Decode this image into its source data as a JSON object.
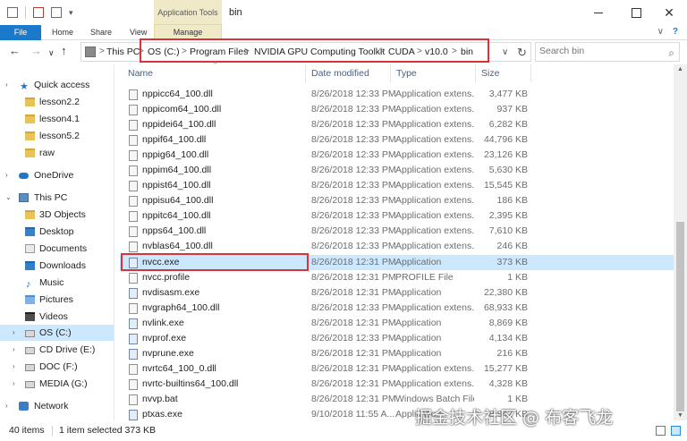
{
  "window": {
    "title": "bin",
    "contextual_tab_group": "Application Tools",
    "close_glyph": "✕"
  },
  "ribbon": {
    "tabs": [
      "File",
      "Home",
      "Share",
      "View",
      "Manage"
    ],
    "collapse_glyph": "∨",
    "help_glyph": "?"
  },
  "address": {
    "back": "←",
    "forward": "→",
    "recent": "∨",
    "up": "↑",
    "crumbs": [
      "This PC",
      "OS (C:)",
      "Program Files",
      "NVIDIA GPU Computing Toolkit",
      "CUDA",
      "v10.0",
      "bin"
    ],
    "separator": ">",
    "refresh": "↻"
  },
  "search": {
    "placeholder": "Search bin"
  },
  "nav_pane": {
    "items": [
      {
        "label": "Quick access",
        "icon": "star-icon"
      },
      {
        "label": "lesson2.2",
        "icon": "folder-icon"
      },
      {
        "label": "lesson4.1",
        "icon": "folder-icon"
      },
      {
        "label": "lesson5.2",
        "icon": "folder-icon"
      },
      {
        "label": "raw",
        "icon": "folder-icon"
      },
      {
        "label": "OneDrive",
        "icon": "cloud-icon"
      },
      {
        "label": "This PC",
        "icon": "computer-icon"
      },
      {
        "label": "3D Objects",
        "icon": "folder-icon"
      },
      {
        "label": "Desktop",
        "icon": "folder-icon"
      },
      {
        "label": "Documents",
        "icon": "folder-icon"
      },
      {
        "label": "Downloads",
        "icon": "folder-icon"
      },
      {
        "label": "Music",
        "icon": "music-icon"
      },
      {
        "label": "Pictures",
        "icon": "folder-icon"
      },
      {
        "label": "Videos",
        "icon": "folder-icon"
      },
      {
        "label": "OS (C:)",
        "icon": "drive-icon",
        "selected": true
      },
      {
        "label": "CD Drive (E:)",
        "icon": "drive-icon"
      },
      {
        "label": "DOC (F:)",
        "icon": "drive-icon"
      },
      {
        "label": "MEDIA (G:)",
        "icon": "drive-icon"
      },
      {
        "label": "Network",
        "icon": "network-icon"
      }
    ]
  },
  "columns": {
    "name": "Name",
    "date": "Date modified",
    "type": "Type",
    "size": "Size"
  },
  "files": [
    {
      "name": "nppicc64_100.dll",
      "date": "8/26/2018 12:33 PM",
      "type": "Application extens...",
      "size": "3,477 KB"
    },
    {
      "name": "nppicom64_100.dll",
      "date": "8/26/2018 12:33 PM",
      "type": "Application extens...",
      "size": "937 KB"
    },
    {
      "name": "nppidei64_100.dll",
      "date": "8/26/2018 12:33 PM",
      "type": "Application extens...",
      "size": "6,282 KB"
    },
    {
      "name": "nppif64_100.dll",
      "date": "8/26/2018 12:33 PM",
      "type": "Application extens...",
      "size": "44,796 KB"
    },
    {
      "name": "nppig64_100.dll",
      "date": "8/26/2018 12:33 PM",
      "type": "Application extens...",
      "size": "23,126 KB"
    },
    {
      "name": "nppim64_100.dll",
      "date": "8/26/2018 12:33 PM",
      "type": "Application extens...",
      "size": "5,630 KB"
    },
    {
      "name": "nppist64_100.dll",
      "date": "8/26/2018 12:33 PM",
      "type": "Application extens...",
      "size": "15,545 KB"
    },
    {
      "name": "nppisu64_100.dll",
      "date": "8/26/2018 12:33 PM",
      "type": "Application extens...",
      "size": "186 KB"
    },
    {
      "name": "nppitc64_100.dll",
      "date": "8/26/2018 12:33 PM",
      "type": "Application extens...",
      "size": "2,395 KB"
    },
    {
      "name": "npps64_100.dll",
      "date": "8/26/2018 12:33 PM",
      "type": "Application extens...",
      "size": "7,610 KB"
    },
    {
      "name": "nvblas64_100.dll",
      "date": "8/26/2018 12:33 PM",
      "type": "Application extens...",
      "size": "246 KB"
    },
    {
      "name": "nvcc.exe",
      "date": "8/26/2018 12:31 PM",
      "type": "Application",
      "size": "373 KB",
      "selected": true
    },
    {
      "name": "nvcc.profile",
      "date": "8/26/2018 12:31 PM",
      "type": "PROFILE File",
      "size": "1 KB"
    },
    {
      "name": "nvdisasm.exe",
      "date": "8/26/2018 12:31 PM",
      "type": "Application",
      "size": "22,380 KB"
    },
    {
      "name": "nvgraph64_100.dll",
      "date": "8/26/2018 12:33 PM",
      "type": "Application extens...",
      "size": "68,933 KB"
    },
    {
      "name": "nvlink.exe",
      "date": "8/26/2018 12:31 PM",
      "type": "Application",
      "size": "8,869 KB"
    },
    {
      "name": "nvprof.exe",
      "date": "8/26/2018 12:33 PM",
      "type": "Application",
      "size": "4,134 KB"
    },
    {
      "name": "nvprune.exe",
      "date": "8/26/2018 12:31 PM",
      "type": "Application",
      "size": "216 KB"
    },
    {
      "name": "nvrtc64_100_0.dll",
      "date": "8/26/2018 12:31 PM",
      "type": "Application extens...",
      "size": "15,277 KB"
    },
    {
      "name": "nvrtc-builtins64_100.dll",
      "date": "8/26/2018 12:31 PM",
      "type": "Application extens...",
      "size": "4,328 KB"
    },
    {
      "name": "nvvp.bat",
      "date": "8/26/2018 12:31 PM",
      "type": "Windows Batch File",
      "size": "1 KB"
    },
    {
      "name": "ptxas.exe",
      "date": "9/10/2018 11:55 A...",
      "type": "Application",
      "size": "8,842 KB"
    }
  ],
  "status": {
    "count": "40 items",
    "selection": "1 item selected  373 KB"
  },
  "watermark": "掘金技术社区 @ 布客飞龙",
  "colors": {
    "accent": "#1979ca",
    "selection": "#cce8ff",
    "highlight_box": "#d9323a",
    "contextual_tab": "#f0e9c8"
  }
}
